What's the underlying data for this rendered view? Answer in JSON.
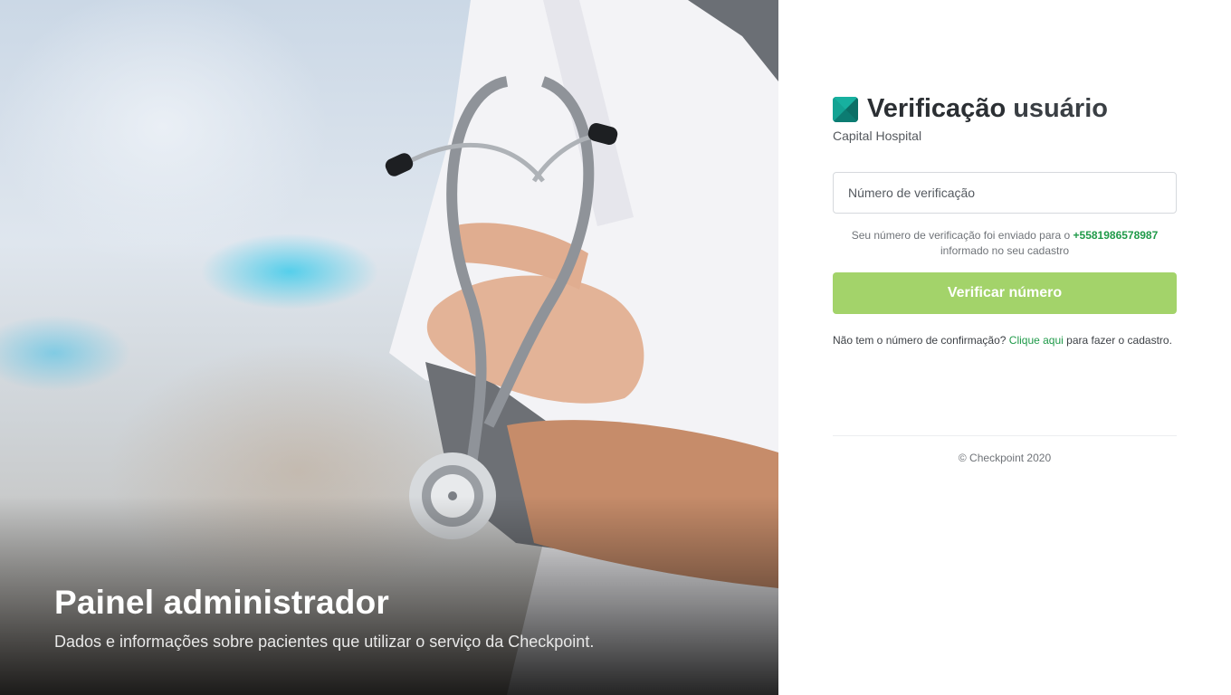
{
  "hero": {
    "title": "Painel administrador",
    "subtitle": "Dados e informações sobre pacientes que utilizar o serviço da Checkpoint."
  },
  "brand": {
    "title_strong": "Verificação",
    "title_light": "usuário",
    "subtitle": "Capital Hospital",
    "logo_color": "#0f8a7f"
  },
  "form": {
    "verification_placeholder": "Número de verificação",
    "verification_value": "",
    "info_prefix": "Seu número de verificação foi enviado para o",
    "phone": "+5581986578987",
    "info_suffix": "informado no seu cadastro",
    "submit_label": "Verificar número",
    "submit_color": "#a3d36a"
  },
  "help": {
    "prefix": "Não tem o número de confirmação?",
    "link": "Clique aqui",
    "suffix": "para fazer o cadastro.",
    "link_color": "#1f9a49"
  },
  "footer": {
    "copyright": "© Checkpoint 2020"
  }
}
